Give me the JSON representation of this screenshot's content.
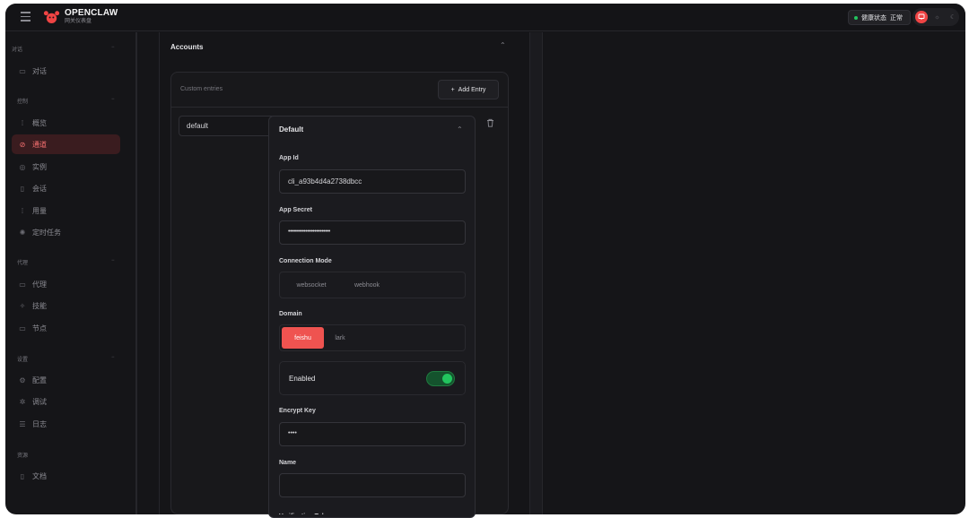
{
  "brand": {
    "title": "OPENCLAW",
    "subtitle": "网关仪表盘"
  },
  "header": {
    "health_label": "健康状态",
    "health_value": "正常",
    "health_color": "#22c55e",
    "theme_icons": [
      "monitor-icon",
      "sun-icon",
      "moon-icon"
    ]
  },
  "sidebar": {
    "groups": [
      {
        "label": "对话",
        "items": [
          {
            "label": "对话",
            "icon": "chat-icon"
          }
        ]
      },
      {
        "label": "控制",
        "items": [
          {
            "label": "概览",
            "icon": "bar-chart-icon"
          },
          {
            "label": "通道",
            "icon": "link-icon",
            "active": true
          },
          {
            "label": "实例",
            "icon": "radio-icon"
          },
          {
            "label": "会话",
            "icon": "file-icon"
          },
          {
            "label": "用量",
            "icon": "bar-chart-icon"
          },
          {
            "label": "定时任务",
            "icon": "gear-icon"
          }
        ]
      },
      {
        "label": "代理",
        "items": [
          {
            "label": "代理",
            "icon": "folder-icon"
          },
          {
            "label": "技能",
            "icon": "sparkle-icon"
          },
          {
            "label": "节点",
            "icon": "monitor-icon"
          }
        ]
      },
      {
        "label": "设置",
        "items": [
          {
            "label": "配置",
            "icon": "gear-icon"
          },
          {
            "label": "调试",
            "icon": "bug-icon"
          },
          {
            "label": "日志",
            "icon": "log-icon"
          }
        ]
      },
      {
        "label": "资源",
        "items": [
          {
            "label": "文档",
            "icon": "book-icon"
          }
        ]
      }
    ]
  },
  "main": {
    "section_title": "Accounts",
    "custom_entries_label": "Custom entries",
    "add_entry_label": "Add Entry",
    "entry_key": "default",
    "panel": {
      "title": "Default",
      "app_id_label": "App Id",
      "app_id_value": "cli_a93b4d4a2738dbcc",
      "app_secret_label": "App Secret",
      "app_secret_value": "••••••••••••••••••••••••",
      "connection_mode_label": "Connection Mode",
      "connection_modes": [
        "websocket",
        "webhook"
      ],
      "domain_label": "Domain",
      "domains": [
        "feishu",
        "lark"
      ],
      "domain_selected": "feishu",
      "enabled_label": "Enabled",
      "enabled": true,
      "encrypt_key_label": "Encrypt Key",
      "encrypt_key_value": "••••",
      "name_label": "Name",
      "name_value": "",
      "verification_token_label": "Verification Token"
    }
  },
  "colors": {
    "accent": "#ef5350",
    "background": "#151518"
  }
}
